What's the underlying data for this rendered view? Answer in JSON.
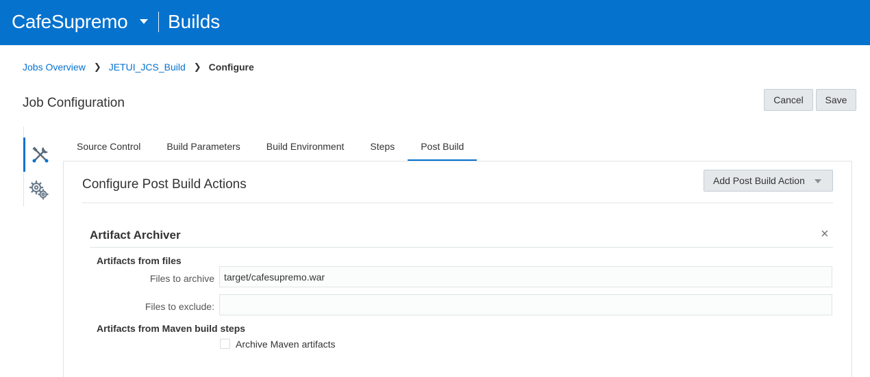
{
  "header": {
    "project_name": "CafeSupremo",
    "section": "Builds"
  },
  "breadcrumb": {
    "items": [
      "Jobs Overview",
      "JETUI_JCS_Build"
    ],
    "current": "Configure",
    "separator": ">"
  },
  "page": {
    "title": "Job Configuration",
    "cancel_label": "Cancel",
    "save_label": "Save"
  },
  "sidenav": {
    "items": [
      {
        "icon": "tools-icon",
        "active": true
      },
      {
        "icon": "gears-icon",
        "active": false
      }
    ]
  },
  "tabs": [
    {
      "label": "Source Control",
      "active": false
    },
    {
      "label": "Build Parameters",
      "active": false
    },
    {
      "label": "Build Environment",
      "active": false
    },
    {
      "label": "Steps",
      "active": false
    },
    {
      "label": "Post Build",
      "active": true
    }
  ],
  "post_build": {
    "title": "Configure Post Build Actions",
    "add_action_label": "Add Post Build Action",
    "archiver": {
      "title": "Artifact Archiver",
      "close_glyph": "×",
      "files_heading": "Artifacts from files",
      "files_to_archive_label": "Files to archive",
      "files_to_archive_value": "target/cafesupremo.war",
      "files_to_exclude_label": "Files to exclude:",
      "files_to_exclude_value": "",
      "maven_heading": "Artifacts from Maven build steps",
      "maven_checkbox_label": "Archive Maven artifacts",
      "maven_checkbox_checked": false
    }
  },
  "colors": {
    "brand": "#0572ce",
    "header_text": "#ffffff",
    "link": "#0572ce",
    "button_bg": "#e4e8ea",
    "border": "#dfe4e7"
  }
}
